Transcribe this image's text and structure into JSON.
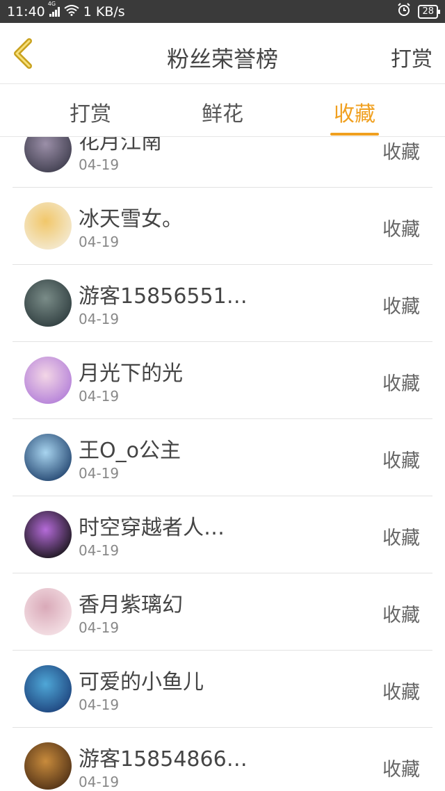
{
  "status_bar": {
    "time": "11:40",
    "network": "4G",
    "speed": "1 KB/s",
    "battery": "28",
    "icons": [
      "signal-icon",
      "wifi-icon",
      "alarm-icon",
      "battery-icon"
    ]
  },
  "nav": {
    "title": "粉丝荣誉榜",
    "action": "打赏",
    "back_icon": "chevron-left-icon"
  },
  "tabs": [
    {
      "label": "打赏",
      "active": false
    },
    {
      "label": "鲜花",
      "active": false
    },
    {
      "label": "收藏",
      "active": true
    }
  ],
  "colors": {
    "accent": "#f0a020",
    "status_bar_bg": "#3a3a3a",
    "text_primary": "#444444",
    "text_secondary": "#888888"
  },
  "list": [
    {
      "name": "花月江南",
      "date": "04-19",
      "type": "收藏",
      "avatar_colors": [
        "#3b3a4a",
        "#9b8fa8"
      ]
    },
    {
      "name": "冰天雪女。",
      "date": "04-19",
      "type": "收藏",
      "avatar_colors": [
        "#f4ecd8",
        "#f1c76a"
      ]
    },
    {
      "name": "游客15856551…",
      "date": "04-19",
      "type": "收藏",
      "avatar_colors": [
        "#2c3a3c",
        "#7a8c88"
      ]
    },
    {
      "name": "月光下的光",
      "date": "04-19",
      "type": "收藏",
      "avatar_colors": [
        "#b07bd8",
        "#f3d6e6"
      ]
    },
    {
      "name": "王O_o公主",
      "date": "04-19",
      "type": "收藏",
      "avatar_colors": [
        "#1d3f6a",
        "#a8d4ef"
      ]
    },
    {
      "name": "时空穿越者人…",
      "date": "04-19",
      "type": "收藏",
      "avatar_colors": [
        "#111111",
        "#b56bd9"
      ]
    },
    {
      "name": "香月紫璃幻",
      "date": "04-19",
      "type": "收藏",
      "avatar_colors": [
        "#f6e4e8",
        "#d9a9b8"
      ]
    },
    {
      "name": "可爱的小鱼儿",
      "date": "04-19",
      "type": "收藏",
      "avatar_colors": [
        "#1b3e78",
        "#4fa7d7"
      ]
    },
    {
      "name": "游客15854866…",
      "date": "04-19",
      "type": "收藏",
      "avatar_colors": [
        "#4a2c14",
        "#c88b3c"
      ]
    }
  ]
}
